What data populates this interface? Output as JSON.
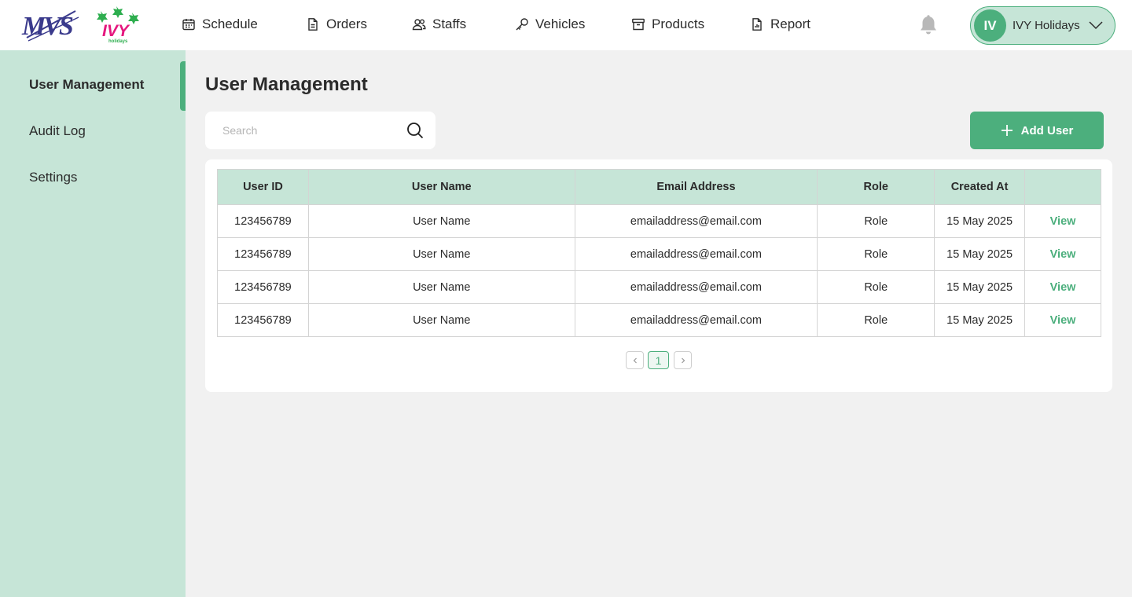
{
  "colors": {
    "accent": "#4caf7d",
    "accent_light": "#c6e5d7",
    "background": "#f1f1f1"
  },
  "header": {
    "logo_primary": "MVS",
    "logo_secondary": "IVY",
    "logo_secondary_tagline": "holidays",
    "nav": [
      {
        "label": "Schedule",
        "icon": "calendar-icon"
      },
      {
        "label": "Orders",
        "icon": "document-icon"
      },
      {
        "label": "Staffs",
        "icon": "users-icon"
      },
      {
        "label": "Vehicles",
        "icon": "key-icon"
      },
      {
        "label": "Products",
        "icon": "archive-icon"
      },
      {
        "label": "Report",
        "icon": "report-icon"
      }
    ],
    "notification_icon": "bell-icon",
    "user": {
      "initials": "IV",
      "name": "IVY Holidays",
      "menu_icon": "chevron-down-icon"
    }
  },
  "sidebar": {
    "items": [
      {
        "label": "User Management",
        "active": true
      },
      {
        "label": "Audit Log",
        "active": false
      },
      {
        "label": "Settings",
        "active": false
      }
    ]
  },
  "main": {
    "title": "User Management",
    "search": {
      "placeholder": "Search",
      "value": ""
    },
    "add_button_label": "Add User",
    "table": {
      "columns": [
        "User ID",
        "User Name",
        "Email Address",
        "Role",
        "Created At",
        ""
      ],
      "rows": [
        {
          "user_id": "123456789",
          "user_name": "User Name",
          "email": "emailaddress@email.com",
          "role": "Role",
          "created_at": "15 May 2025",
          "action": "View"
        },
        {
          "user_id": "123456789",
          "user_name": "User Name",
          "email": "emailaddress@email.com",
          "role": "Role",
          "created_at": "15 May 2025",
          "action": "View"
        },
        {
          "user_id": "123456789",
          "user_name": "User Name",
          "email": "emailaddress@email.com",
          "role": "Role",
          "created_at": "15 May 2025",
          "action": "View"
        },
        {
          "user_id": "123456789",
          "user_name": "User Name",
          "email": "emailaddress@email.com",
          "role": "Role",
          "created_at": "15 May 2025",
          "action": "View"
        }
      ]
    },
    "pagination": {
      "current_page": "1"
    }
  }
}
